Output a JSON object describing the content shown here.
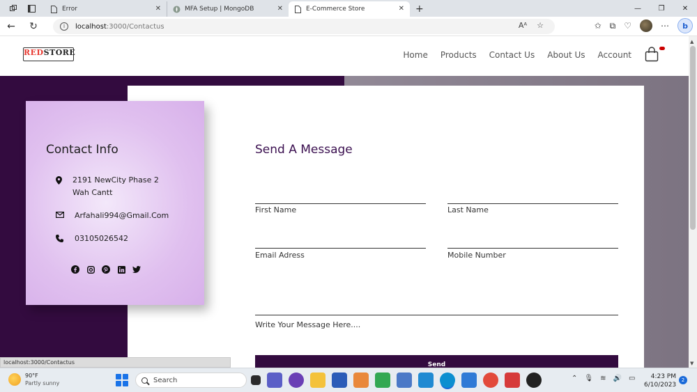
{
  "browser": {
    "tabs": [
      {
        "title": "Error",
        "active": false
      },
      {
        "title": "MFA Setup | MongoDB",
        "active": false
      },
      {
        "title": "E-Commerce Store",
        "active": true
      }
    ],
    "url_host": "localhost",
    "url_path": ":3000/Contactus"
  },
  "site": {
    "logo_red": "RED",
    "logo_black": "STORE",
    "nav": [
      "Home",
      "Products",
      "Contact Us",
      "About Us",
      "Account"
    ]
  },
  "contact_info": {
    "title": "Contact Info",
    "address_line1": "2191 NewCity Phase 2",
    "address_line2": "Wah Cantt",
    "email": "Arfahali994@Gmail.Com",
    "phone": "03105026542"
  },
  "message_form": {
    "title": "Send A Message",
    "first_name_label": "First Name",
    "last_name_label": "Last Name",
    "email_label": "Email Adress",
    "mobile_label": "Mobile Number",
    "message_label": "Write Your Message Here....",
    "send_label": "Send"
  },
  "status_bar_text": "localhost:3000/Contactus",
  "taskbar": {
    "weather_temp": "90°F",
    "weather_desc": "Partly sunny",
    "search_label": "Search",
    "time": "4:23 PM",
    "date": "6/10/2023",
    "notification_count": "2"
  },
  "colors": {
    "brand_dark": "#330b3f",
    "accent_title": "#3b1050",
    "card_panel": "#e0c0ef"
  }
}
